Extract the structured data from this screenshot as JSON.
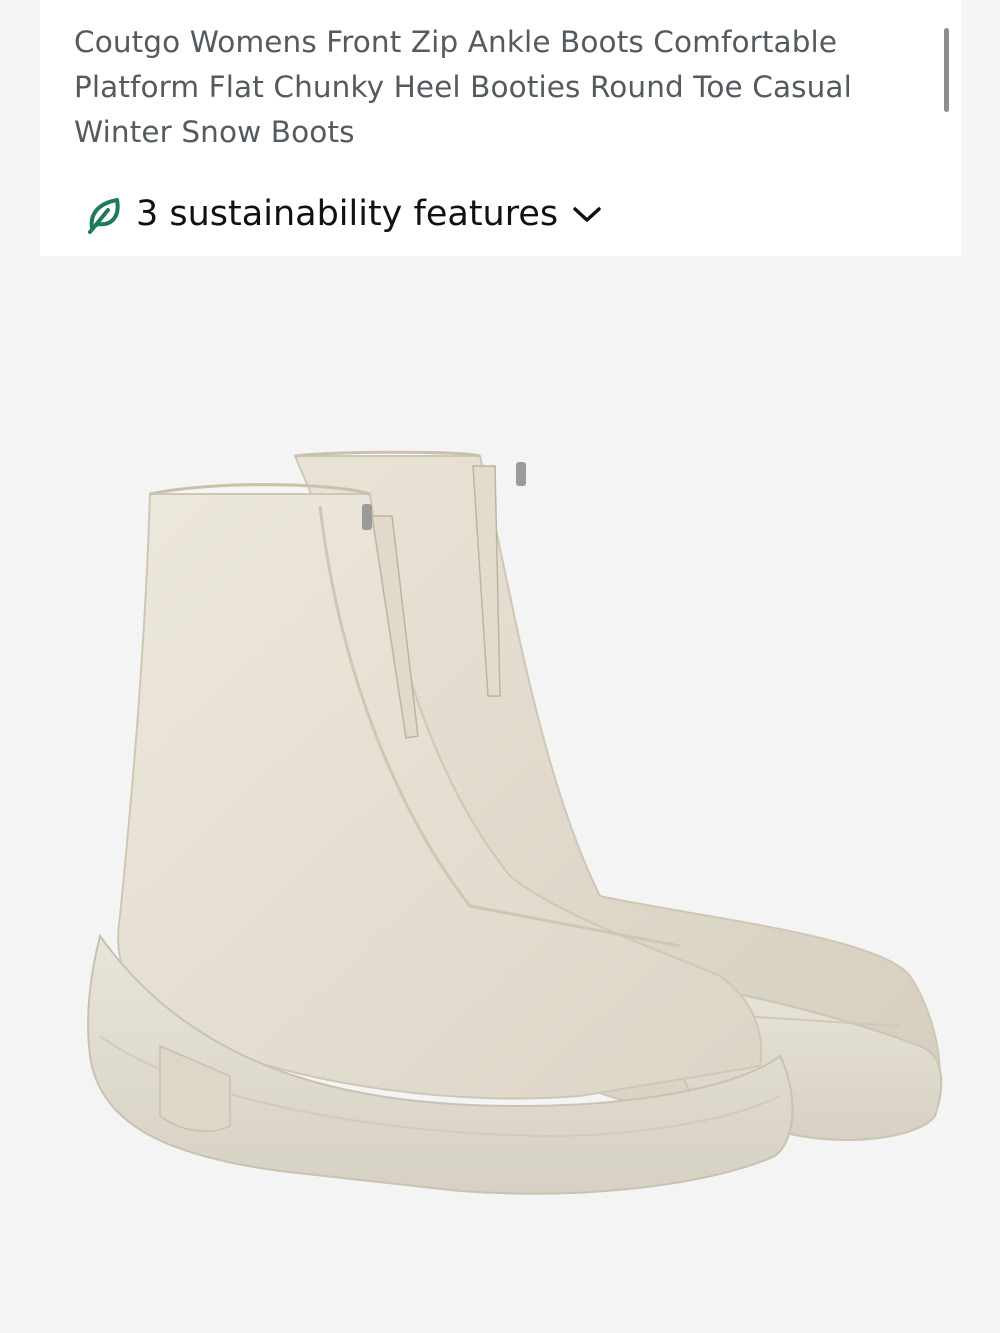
{
  "product": {
    "title": "Coutgo Womens Front Zip Ankle Boots Comfortable Platform Flat Chunky Heel Booties Round Toe Casual Winter Snow Boots",
    "sustainability_label": "3 sustainability features",
    "sustainability_icon": "leaf-icon",
    "expand_icon": "chevron-down-icon",
    "accent_color": "#1f7a5c"
  },
  "gallery": {
    "image_alt": "Cream leather front zip platform ankle boots",
    "background_color": "#f4f4f4"
  }
}
